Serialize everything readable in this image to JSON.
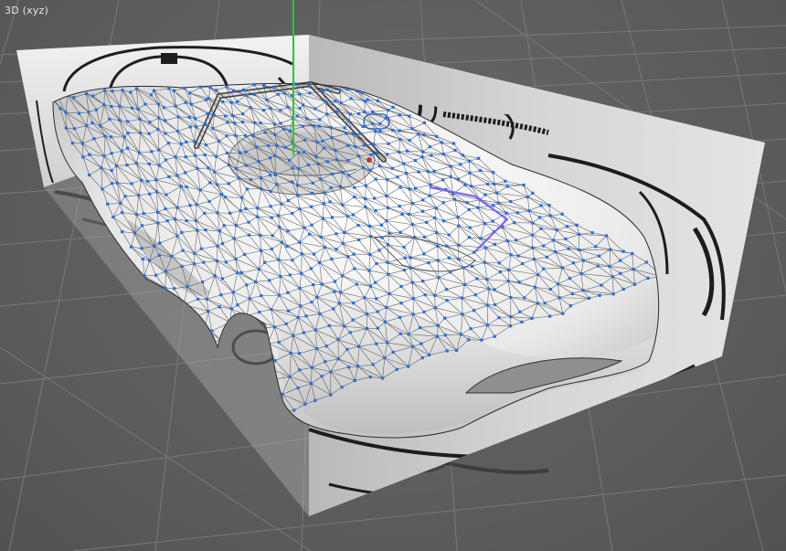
{
  "viewport": {
    "label": "3D (xyz)",
    "view_mode": "perspective",
    "background_color": "#5f5f5f",
    "grid_color": "#7d7d7d",
    "y_axis_color": "#22d022",
    "mesh_edge_color": "#3a3a3a",
    "vertex_color": "#1f6fe8",
    "selection_color": "#7a5cff"
  },
  "scene": {
    "object": "race-car-body-mesh",
    "reference_images": [
      "side-blueprint",
      "front-blueprint",
      "top-blueprint"
    ],
    "show_grid": true,
    "show_wireframe": true,
    "show_vertices": true
  }
}
